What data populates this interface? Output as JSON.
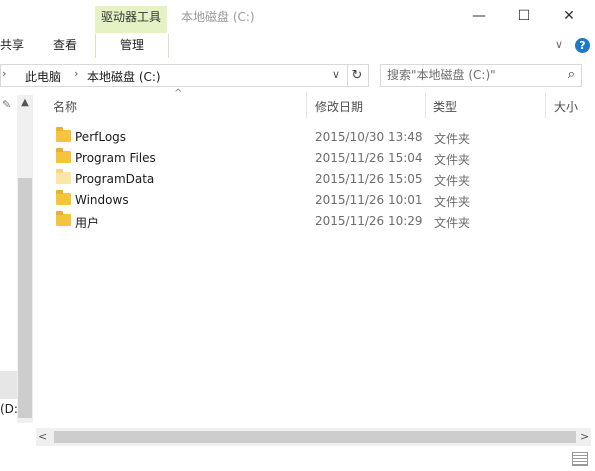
{
  "window": {
    "title": "本地磁盘 (C:)",
    "context_tab_title": "驱动器工具",
    "minimize": "—",
    "maximize": "☐",
    "close": "✕"
  },
  "ribbon": {
    "tabs": [
      "共享",
      "查看",
      "管理"
    ],
    "expand_glyph": "∨",
    "help_glyph": "?"
  },
  "address": {
    "back_glyph": "›",
    "crumbs": [
      "此电脑",
      "本地磁盘 (C:)"
    ],
    "separator_glyph": "›",
    "dropdown_glyph": "∨",
    "refresh_glyph": "↻"
  },
  "search": {
    "placeholder": "搜索\"本地磁盘 (C:)\"",
    "icon_glyph": "⌕"
  },
  "columns": {
    "name": "名称",
    "date": "修改日期",
    "type": "类型",
    "size": "大小"
  },
  "files": [
    {
      "name": "PerfLogs",
      "date": "2015/10/30 13:48",
      "type": "文件夹",
      "faded": false
    },
    {
      "name": "Program Files",
      "date": "2015/11/26 15:04",
      "type": "文件夹",
      "faded": false
    },
    {
      "name": "ProgramData",
      "date": "2015/11/26 15:05",
      "type": "文件夹",
      "faded": true
    },
    {
      "name": "Windows",
      "date": "2015/11/26 10:01",
      "type": "文件夹",
      "faded": false
    },
    {
      "name": "用户",
      "date": "2015/11/26 10:29",
      "type": "文件夹",
      "faded": false
    }
  ],
  "nav": {
    "drive_label": "(D:",
    "pin_glyph": "✎",
    "up_glyph": "▲"
  },
  "scroll": {
    "left_glyph": "<",
    "right_glyph": ">"
  },
  "colors": {
    "context_tab": "#e4f2c4",
    "folder": "#f4c43c",
    "help": "#1979ca"
  }
}
